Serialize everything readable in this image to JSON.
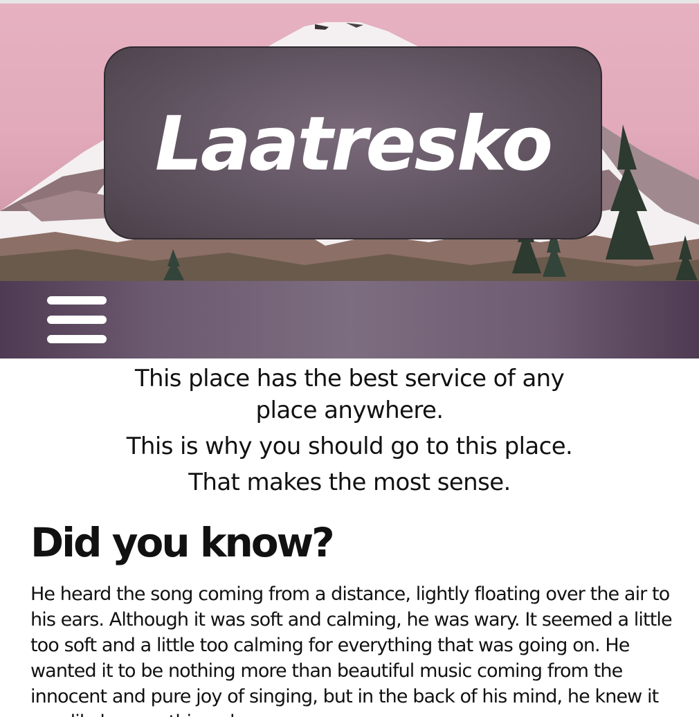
{
  "header": {
    "brand": "Laatresko"
  },
  "nav": {
    "menu_icon": "hamburger-menu-icon"
  },
  "taglines": {
    "line1": "This place has the best service of any place anywhere.",
    "line2": "This is why you should go to this place.",
    "line3": "That makes the most sense."
  },
  "article": {
    "heading": "Did you know?",
    "body": "He heard the song coming from a distance, lightly floating over the air to his ears. Although it was soft and calming, he was wary. It seemed a little too soft and a little too calming for everything that was going on. He wanted it to be nothing more than beautiful music coming from the innocent and pure joy of singing, but in the back of his mind, he knew it was likely something else."
  },
  "colors": {
    "sky": "#e2aabb",
    "panel": "#605360",
    "nav": "#7d6d80",
    "text": "#111111"
  }
}
